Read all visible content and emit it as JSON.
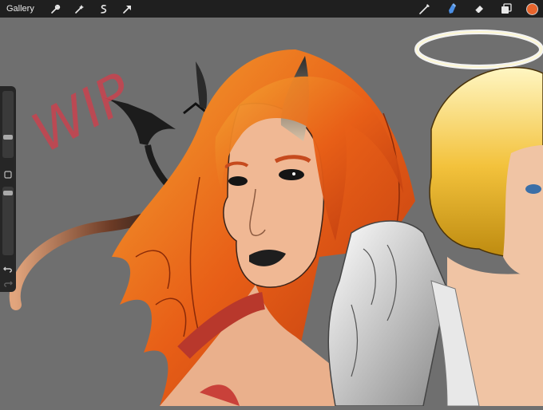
{
  "topbar": {
    "gallery_label": "Gallery",
    "left_tools": [
      "wrench-icon",
      "magic-wand-icon",
      "selection-icon",
      "transform-arrow-icon"
    ],
    "right_tools": [
      "brush-icon",
      "smudge-icon",
      "eraser-icon",
      "layers-icon"
    ],
    "active_color": "#e8642c"
  },
  "sidebar": {
    "brush_size_level": 0.5,
    "opacity_level": 0.05,
    "buttons": [
      "modify-square-icon",
      "undo-icon",
      "redo-icon"
    ]
  },
  "canvas": {
    "artwork_text": "WIP",
    "background_color": "#6f6f6f",
    "text_color": "#c9434f"
  }
}
